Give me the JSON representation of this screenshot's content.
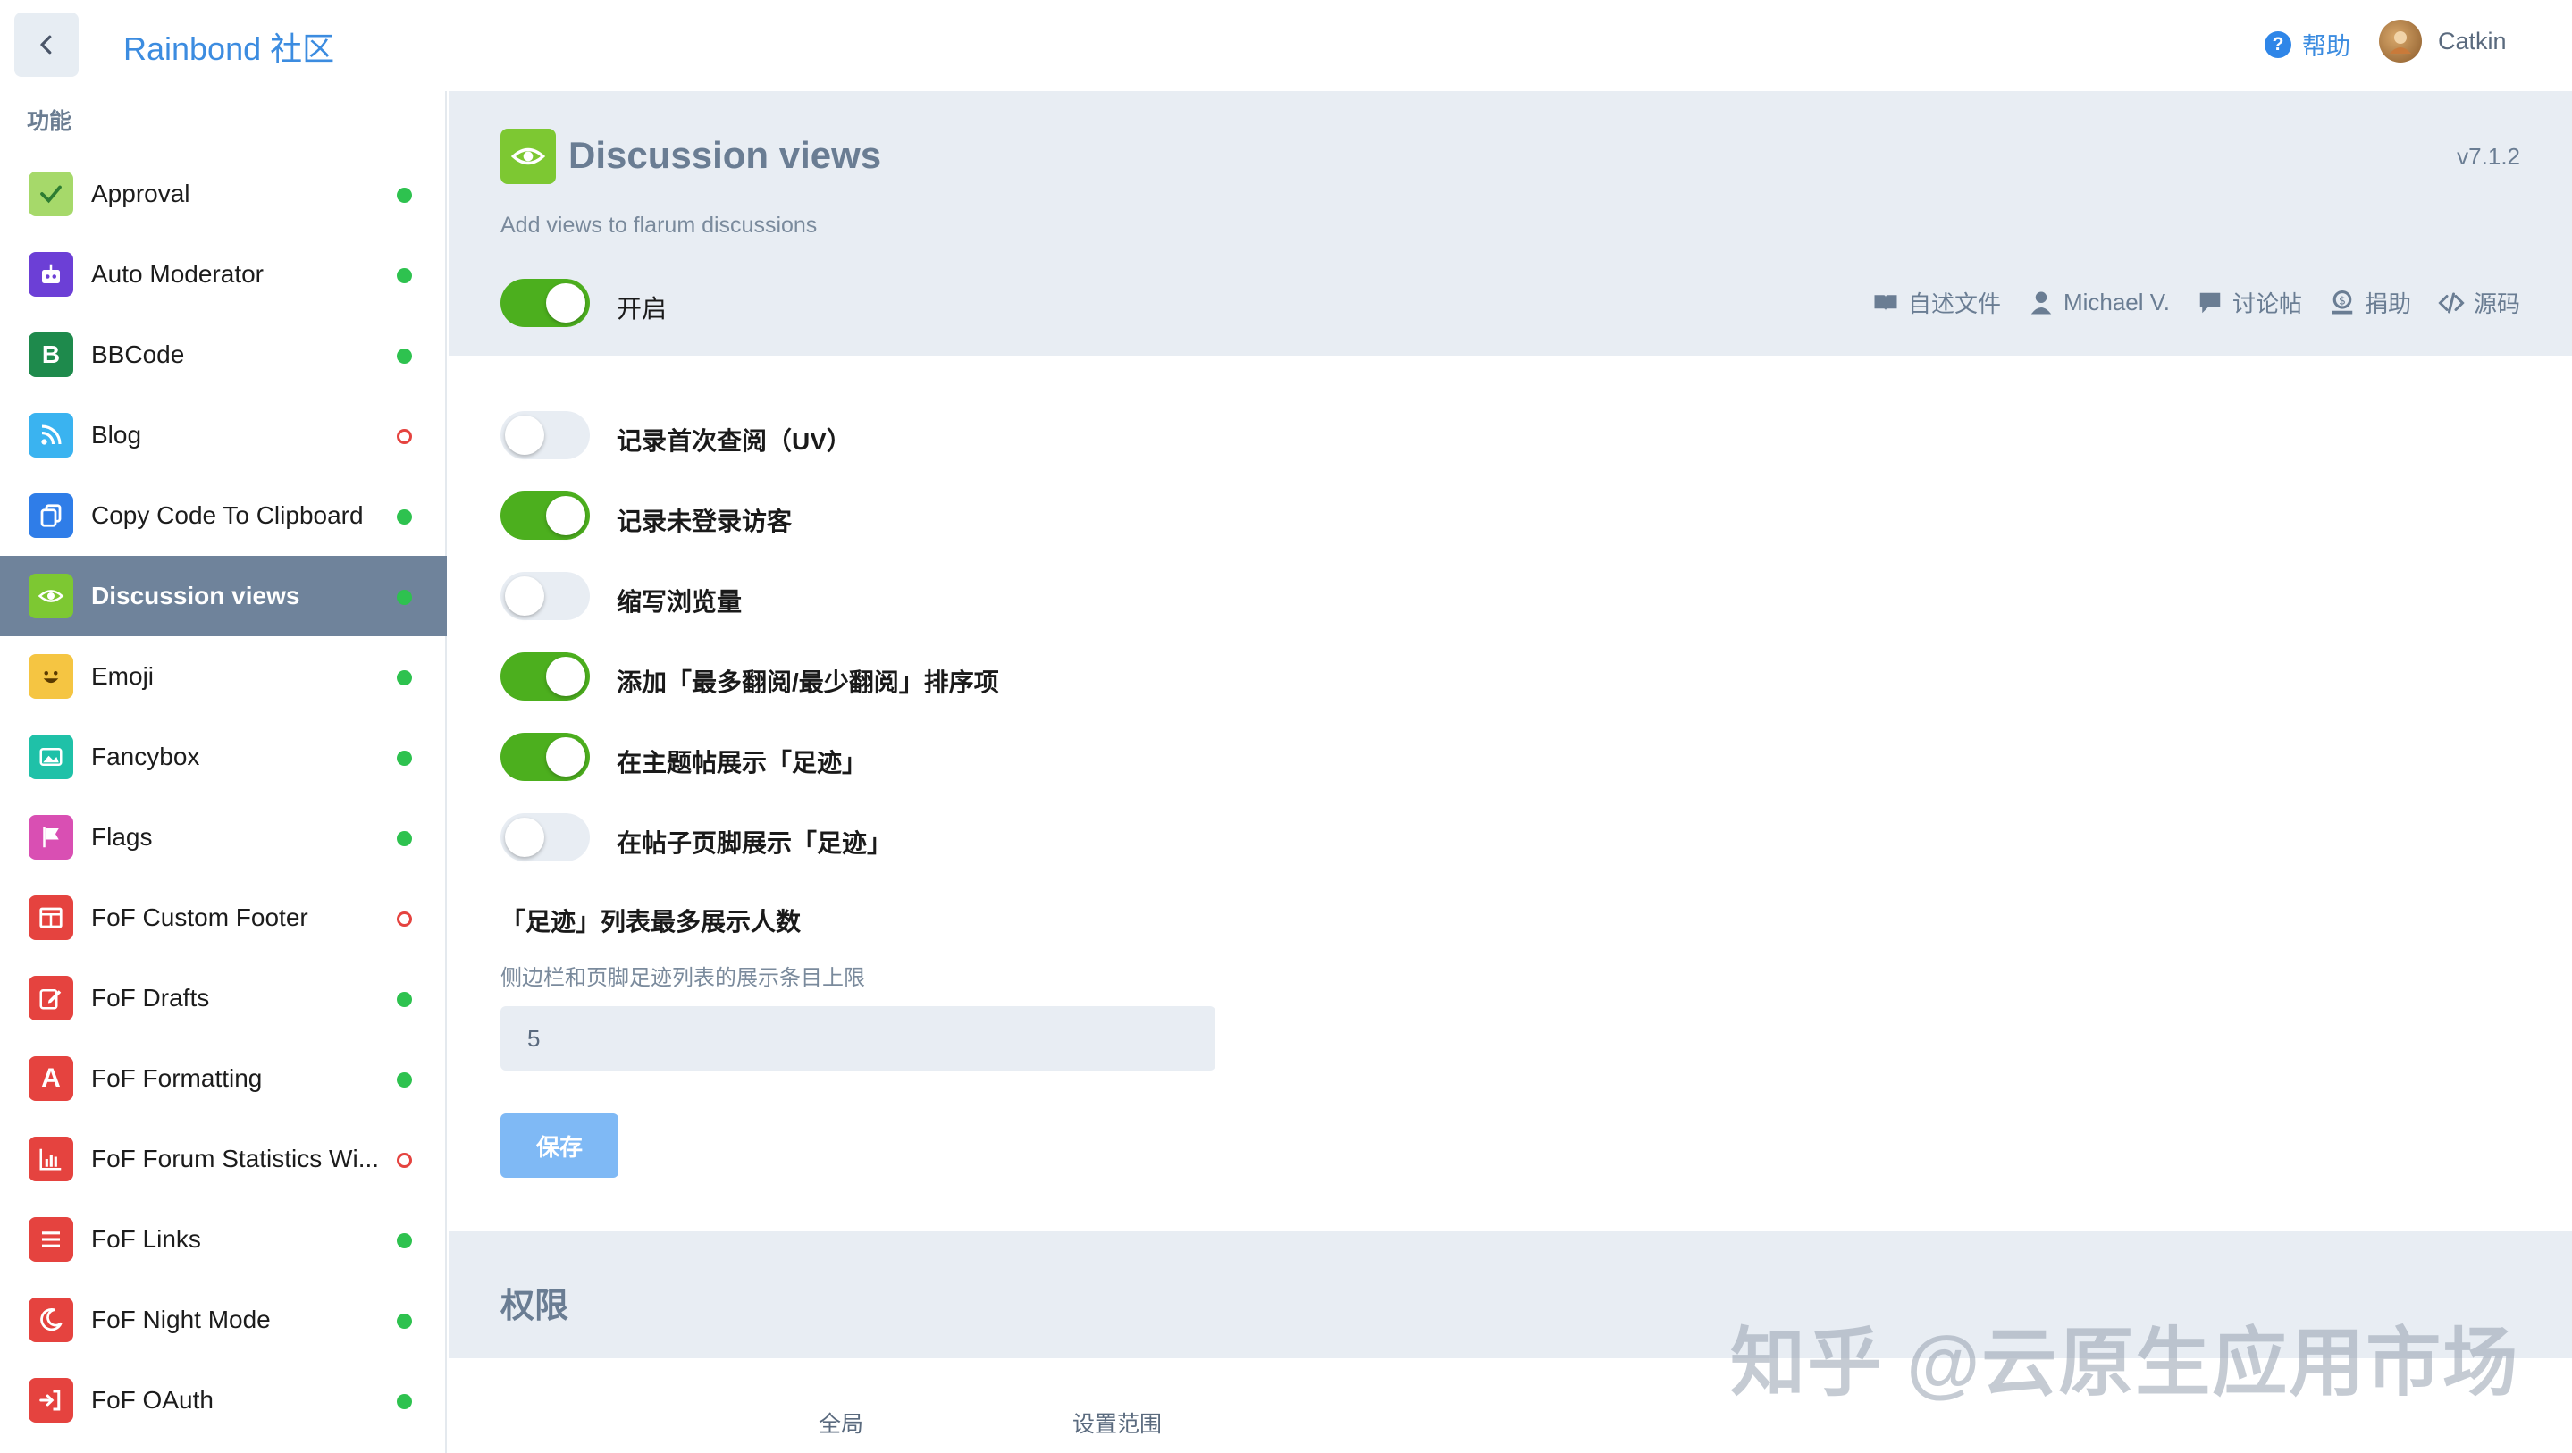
{
  "header": {
    "site_title": "Rainbond 社区",
    "help_label": "帮助",
    "user_name": "Catkin"
  },
  "sidebar": {
    "heading": "功能",
    "items": [
      {
        "label": "Approval",
        "icon": "check-icon",
        "color": "#a6d96a",
        "enabled": true,
        "active": false
      },
      {
        "label": "Auto Moderator",
        "icon": "robot-icon",
        "color": "#6c3fd6",
        "enabled": true,
        "active": false
      },
      {
        "label": "BBCode",
        "icon": "letter-b-icon",
        "color": "#1e8a4c",
        "enabled": true,
        "active": false
      },
      {
        "label": "Blog",
        "icon": "blog-icon",
        "color": "#3ab3f0",
        "enabled": false,
        "active": false
      },
      {
        "label": "Copy Code To Clipboard",
        "icon": "copy-icon",
        "color": "#2f7de8",
        "enabled": true,
        "active": false
      },
      {
        "label": "Discussion views",
        "icon": "eye-icon",
        "color": "#7dc832",
        "enabled": true,
        "active": true
      },
      {
        "label": "Emoji",
        "icon": "smile-icon",
        "color": "#f5c542",
        "enabled": true,
        "active": false
      },
      {
        "label": "Fancybox",
        "icon": "image-icon",
        "color": "#1fc1a8",
        "enabled": true,
        "active": false
      },
      {
        "label": "Flags",
        "icon": "flag-icon",
        "color": "#d94fb3",
        "enabled": true,
        "active": false
      },
      {
        "label": "FoF Custom Footer",
        "icon": "footer-icon",
        "color": "#e5433f",
        "enabled": false,
        "active": false
      },
      {
        "label": "FoF Drafts",
        "icon": "edit-icon",
        "color": "#e5433f",
        "enabled": true,
        "active": false
      },
      {
        "label": "FoF Formatting",
        "icon": "letter-a-icon",
        "color": "#e5433f",
        "enabled": true,
        "active": false
      },
      {
        "label": "FoF Forum Statistics Wi...",
        "icon": "chart-icon",
        "color": "#e5433f",
        "enabled": false,
        "active": false
      },
      {
        "label": "FoF Links",
        "icon": "list-icon",
        "color": "#e5433f",
        "enabled": true,
        "active": false
      },
      {
        "label": "FoF Night Mode",
        "icon": "moon-icon",
        "color": "#e5433f",
        "enabled": true,
        "active": false
      },
      {
        "label": "FoF OAuth",
        "icon": "signin-icon",
        "color": "#e5433f",
        "enabled": true,
        "active": false
      }
    ]
  },
  "extension": {
    "title": "Discussion views",
    "version": "v7.1.2",
    "description": "Add views to flarum discussions",
    "enable_label": "开启",
    "enabled": true,
    "links": [
      {
        "label": "自述文件",
        "icon": "book-icon"
      },
      {
        "label": "Michael V.",
        "icon": "user-icon"
      },
      {
        "label": "讨论帖",
        "icon": "comment-icon"
      },
      {
        "label": "捐助",
        "icon": "donate-icon"
      },
      {
        "label": "源码",
        "icon": "code-icon"
      }
    ]
  },
  "settings": {
    "toggles": [
      {
        "label": "记录首次查阅（UV）",
        "on": false
      },
      {
        "label": "记录未登录访客",
        "on": true
      },
      {
        "label": "缩写浏览量",
        "on": false
      },
      {
        "label": "添加「最多翻阅/最少翻阅」排序项",
        "on": true
      },
      {
        "label": "在主题帖展示「足迹」",
        "on": true
      },
      {
        "label": "在帖子页脚展示「足迹」",
        "on": false
      }
    ],
    "max_users_title": "「足迹」列表最多展示人数",
    "max_users_help": "侧边栏和页脚足迹列表的展示条目上限",
    "max_users_value": "5",
    "save_label": "保存"
  },
  "permissions": {
    "title": "权限",
    "col_global": "全局",
    "col_scope": "设置范围"
  },
  "watermark": "知乎 @云原生应用市场"
}
